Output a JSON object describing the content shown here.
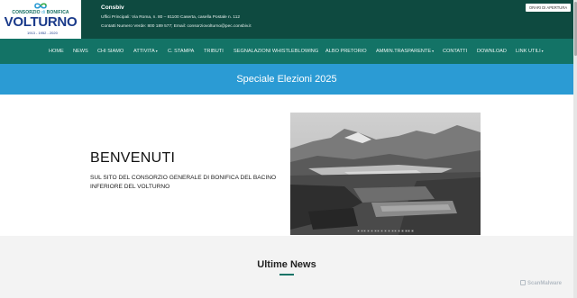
{
  "header": {
    "logo": {
      "line1_a": "CONSORZIO",
      "line1_b": "di",
      "line1_c": "BONIFICA",
      "line2": "VOLTURNO",
      "line3": "1913 - 1952 - 2020"
    },
    "org_name": "Consbiv",
    "contact_line1": "Uffici Principali: Via Roma, n. 80 – 81100 Caserta, casella Postale n. 112",
    "contact_line2": "Contatti Numero Verde: 800 189 577; Email: consorziovolturno@pec.consbiv.it",
    "hours_button": "ORARI DI APERTURA"
  },
  "nav": {
    "items": [
      {
        "label": "HOME"
      },
      {
        "label": "NEWS"
      },
      {
        "label": "CHI SIAMO"
      },
      {
        "label": "ATTIVITA",
        "dropdown": true
      },
      {
        "label": "C. STAMPA"
      },
      {
        "label": "TRIBUTI"
      },
      {
        "label": "SEGNALAZIONI WHISTLEBLOWING"
      },
      {
        "label": "ALBO PRETORIO"
      },
      {
        "label": "AMMIN.TRASPARENTE",
        "dropdown": true
      },
      {
        "label": "CONTATTI"
      },
      {
        "label": "DOWNLOAD"
      },
      {
        "label": "LINK UTILI",
        "dropdown": true
      }
    ],
    "caret": "▾"
  },
  "banner": {
    "text": "Speciale Elezioni 2025"
  },
  "welcome": {
    "title": "BENVENUTI",
    "subtitle": "SUL SITO DEL CONSORZIO GENERALE DI BONIFICA DEL BACINO INFERIORE DEL VOLTURNO",
    "carousel": {
      "slide_count": 17,
      "active_index": 0
    }
  },
  "news": {
    "title": "Ultime News"
  },
  "watermark": {
    "text": "ScanMalware"
  },
  "colors": {
    "header_bg": "#0e4a40",
    "nav_bg": "#137366",
    "banner_bg": "#2b9bd4",
    "news_bg": "#f3f3f3"
  }
}
